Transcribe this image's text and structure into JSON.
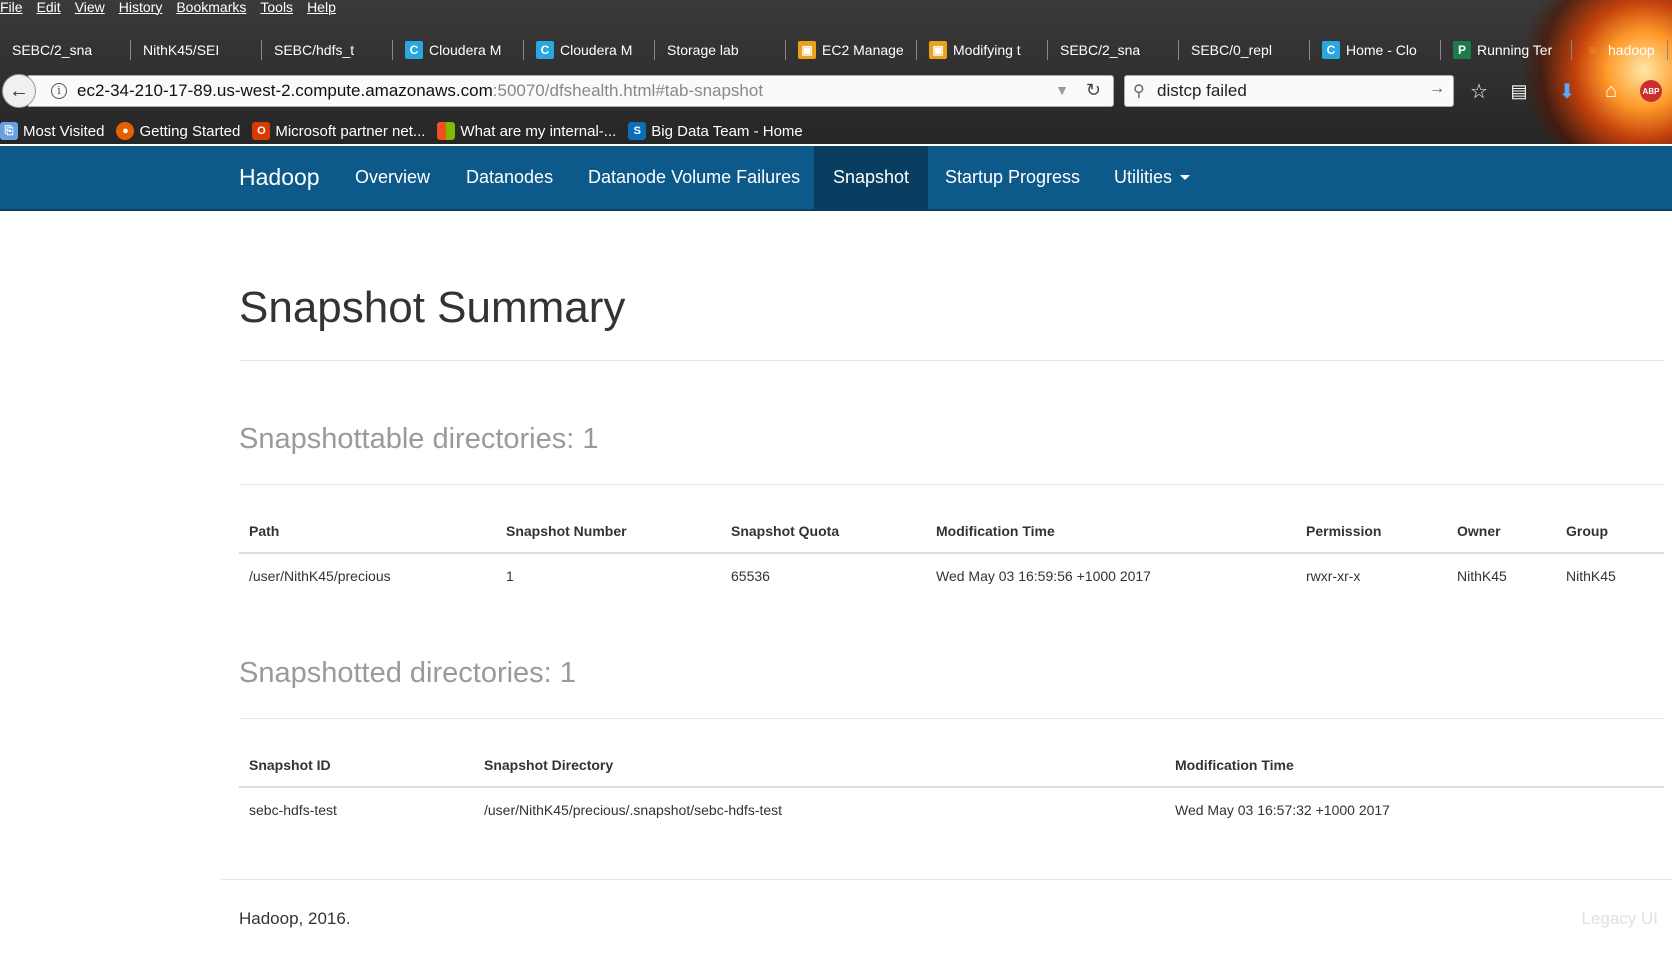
{
  "browser": {
    "menu": [
      "File",
      "Edit",
      "View",
      "History",
      "Bookmarks",
      "Tools",
      "Help"
    ],
    "tabs": [
      {
        "title": "SEBC/2_sna",
        "favicon": "blank"
      },
      {
        "title": "NithK45/SEI",
        "favicon": "blank"
      },
      {
        "title": "SEBC/hdfs_t",
        "favicon": "blank"
      },
      {
        "title": "Cloudera M",
        "favicon": "cloudera-icon"
      },
      {
        "title": "Cloudera M",
        "favicon": "cloudera-icon"
      },
      {
        "title": "Storage lab",
        "favicon": "blank"
      },
      {
        "title": "EC2 Manage",
        "favicon": "aws-icon"
      },
      {
        "title": "Modifying t",
        "favicon": "aws-icon"
      },
      {
        "title": "SEBC/2_sna",
        "favicon": "blank"
      },
      {
        "title": "SEBC/0_repl",
        "favicon": "blank"
      },
      {
        "title": "Home - Clo",
        "favicon": "cloudera-icon"
      },
      {
        "title": "Running Ter",
        "favicon": "p-icon"
      },
      {
        "title": "hadoop",
        "favicon": "stackoverflow-icon"
      }
    ],
    "url": {
      "host": "ec2-34-210-17-89.us-west-2.compute.amazonaws.com",
      "path": ":50070/dfshealth.html#tab-snapshot"
    },
    "search": {
      "value": "distcp failed"
    },
    "bookmarks": [
      {
        "label": "Most Visited",
        "icon": "most-visited-icon"
      },
      {
        "label": "Getting Started",
        "icon": "firefox-icon"
      },
      {
        "label": "Microsoft partner net...",
        "icon": "office-icon"
      },
      {
        "label": "What are my internal-...",
        "icon": "windows-icon"
      },
      {
        "label": "Big Data Team - Home",
        "icon": "sharepoint-icon"
      }
    ]
  },
  "navbar": {
    "brand": "Hadoop",
    "items": [
      "Overview",
      "Datanodes",
      "Datanode Volume Failures",
      "Snapshot",
      "Startup Progress",
      "Utilities"
    ],
    "active": "Snapshot"
  },
  "page": {
    "title": "Snapshot Summary",
    "snapshottable": {
      "heading": "Snapshottable directories: 1",
      "headers": [
        "Path",
        "Snapshot Number",
        "Snapshot Quota",
        "Modification Time",
        "Permission",
        "Owner",
        "Group"
      ],
      "rows": [
        [
          "/user/NithK45/precious",
          "1",
          "65536",
          "Wed May 03 16:59:56 +1000 2017",
          "rwxr-xr-x",
          "NithK45",
          "NithK45"
        ]
      ]
    },
    "snapshotted": {
      "heading": "Snapshotted directories: 1",
      "headers": [
        "Snapshot ID",
        "Snapshot Directory",
        "Modification Time"
      ],
      "rows": [
        [
          "sebc-hdfs-test",
          "/user/NithK45/precious/.snapshot/sebc-hdfs-test",
          "Wed May 03 16:57:32 +1000 2017"
        ]
      ]
    },
    "footer": {
      "left": "Hadoop, 2016.",
      "right": "Legacy UI"
    }
  }
}
